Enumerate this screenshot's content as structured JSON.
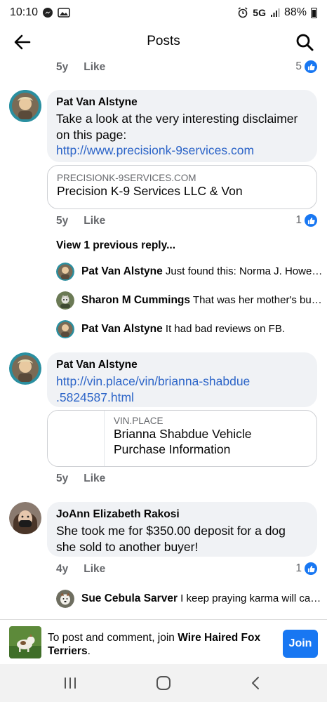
{
  "status_bar": {
    "time": "10:10",
    "network": "5G",
    "battery": "88%"
  },
  "header": {
    "title": "Posts"
  },
  "comments": {
    "top_meta": {
      "time": "5y",
      "like_label": "Like",
      "reaction_count": "5"
    },
    "c1": {
      "name": "Pat Van Alstyne",
      "text": "Take a look at the very interesting disclaimer on this page:",
      "link": "http://www.precisionk-9services.com",
      "card": {
        "domain": "PRECISIONK-9SERVICES.COM",
        "title": "Precision K-9 Services LLC & Von"
      },
      "meta": {
        "time": "5y",
        "like_label": "Like",
        "reaction_count": "1"
      }
    },
    "view_previous": "View 1 previous reply...",
    "replies": [
      {
        "name": "Pat Van Alstyne",
        "text": "Just found this: Norma J. Howe…"
      },
      {
        "name": "Sharon M Cummings",
        "text": "That was her mother's bu…"
      },
      {
        "name": "Pat Van Alstyne",
        "text": "It had bad reviews on FB."
      }
    ],
    "c2": {
      "name": "Pat Van Alstyne",
      "link_line1": "http://vin.place/vin/brianna-shabdue",
      "link_line2": ".5824587.html",
      "card": {
        "domain": "VIN.PLACE",
        "title_line1": "Brianna Shabdue Vehicle",
        "title_line2": "Purchase Information"
      },
      "meta": {
        "time": "5y",
        "like_label": "Like"
      }
    },
    "c3": {
      "name": "JoAnn Elizabeth Rakosi",
      "text_line1": "She took me for $350.00 deposit for a dog",
      "text_line2": "she sold to another buyer!",
      "meta": {
        "time": "4y",
        "like_label": "Like",
        "reaction_count": "1"
      }
    },
    "c3_reply": {
      "name": "Sue Cebula Sarver",
      "text": "I keep praying karma will cat…"
    }
  },
  "join_bar": {
    "prefix": "To post and comment, join ",
    "group": "Wire Haired Fox Terriers",
    "suffix": ".",
    "button": "Join"
  },
  "colors": {
    "accent": "#1877f2",
    "link": "#2d65c8",
    "bubble": "#f0f2f5",
    "meta": "#65676b"
  },
  "icons": {
    "back": "arrow-left-icon",
    "search": "search-icon",
    "like": "thumbs-up-icon",
    "nav_recent": "recent-apps-icon",
    "nav_home": "home-icon",
    "nav_back": "nav-back-icon"
  }
}
